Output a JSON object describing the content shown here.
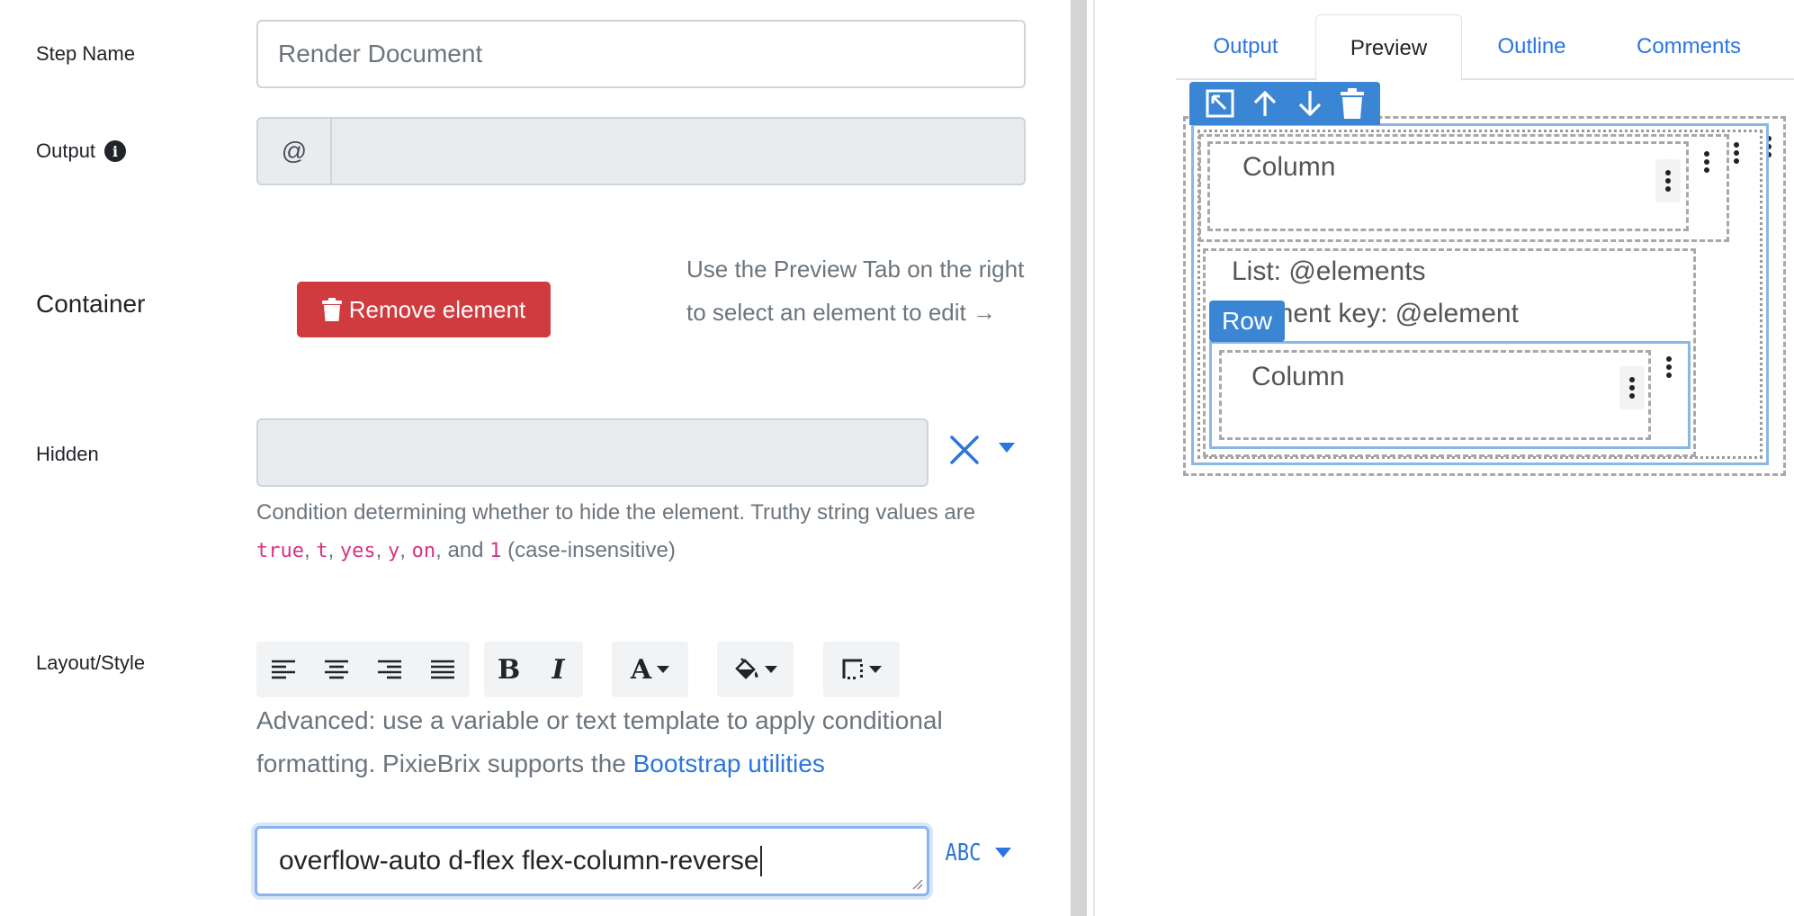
{
  "form": {
    "step_name_label": "Step Name",
    "step_name_value": "Render Document",
    "output_label": "Output",
    "output_prefix": "@",
    "output_value": "",
    "container_title": "Container",
    "remove_button_label": "Remove element",
    "preview_hint": "Use the Preview Tab on the right to select an element to edit →",
    "hidden_label": "Hidden",
    "hidden_value": "",
    "hidden_help_prefix": "Condition determining whether to hide the element. Truthy string values are",
    "truthy_values": [
      "true",
      "t",
      "yes",
      "y",
      "on"
    ],
    "hidden_help_and": "and",
    "truthy_last": "1",
    "hidden_help_suffix": "(case-insensitive)",
    "layout_label": "Layout/Style",
    "layout_help_text": "Advanced: use a variable or text template to apply conditional formatting. PixieBrix supports the",
    "layout_help_link": "Bootstrap utilities",
    "style_value": "overflow-auto d-flex flex-column-reverse",
    "style_type_label": "ABC"
  },
  "toolbar": {
    "align_icons": [
      "align-left-icon",
      "align-center-icon",
      "align-right-icon",
      "align-justify-icon"
    ],
    "format_icons": [
      "bold-icon",
      "italic-icon"
    ],
    "text_color_icon": "font-color-icon",
    "background_icon": "paint-bucket-icon",
    "border_icon": "border-style-icon"
  },
  "preview": {
    "tabs": [
      "Output",
      "Preview",
      "Outline",
      "Comments"
    ],
    "active_tab": "Preview",
    "toolbar_icons": [
      "select-parent-icon",
      "arrow-up-icon",
      "arrow-down-icon",
      "trash-icon"
    ],
    "column_1_label": "Column",
    "list_label": "List: @elements",
    "element_key_label": "Element key: @element",
    "row_badge": "Row",
    "column_2_label": "Column"
  },
  "colors": {
    "accent": "#2a75e0",
    "danger": "#d03b40",
    "selection": "#3a86d4"
  }
}
